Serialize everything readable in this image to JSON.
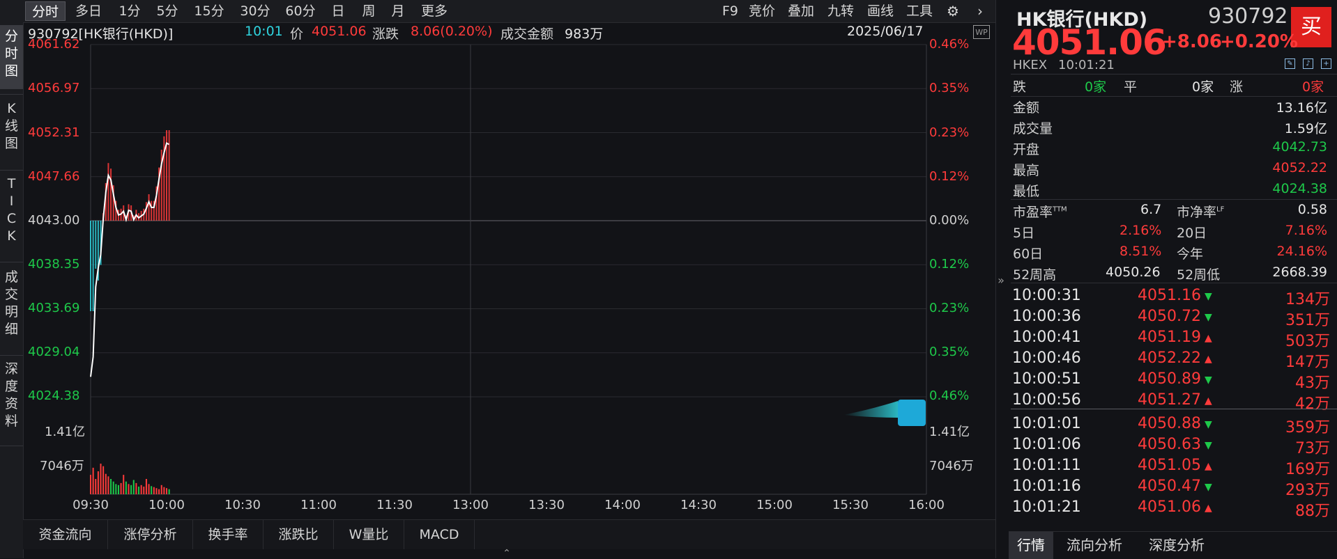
{
  "toolbar": {
    "periods": [
      "分时",
      "多日",
      "1分",
      "5分",
      "15分",
      "30分",
      "60分",
      "日",
      "周",
      "月",
      "更多"
    ],
    "tools": [
      "F9",
      "竞价",
      "叠加",
      "九转",
      "画线",
      "工具"
    ]
  },
  "left_tabs": [
    "分时图",
    "K线图",
    "TICK",
    "成交明细",
    "深度资料"
  ],
  "header": {
    "security": "930792[HK银行(HKD)]",
    "time": "10:01",
    "price_label": "价",
    "price": "4051.06",
    "change_label": "涨跌",
    "change": "8.06(0.20%)",
    "turnover_label": "成交金额",
    "turnover": "983万",
    "date": "2025/06/17"
  },
  "badge": "WP",
  "price_axis_left": [
    "4061.62",
    "4056.97",
    "4052.31",
    "4047.66",
    "4043.00",
    "4038.35",
    "4033.69",
    "4029.04",
    "4024.38"
  ],
  "pct_axis_right": [
    "0.46%",
    "0.35%",
    "0.23%",
    "0.12%",
    "0.00%",
    "0.12%",
    "0.23%",
    "0.35%",
    "0.46%"
  ],
  "volume_axis": {
    "top": "1.41亿",
    "mid": "7046万"
  },
  "time_axis": [
    "09:30",
    "10:00",
    "10:30",
    "11:00",
    "11:30",
    "13:00",
    "13:30",
    "14:00",
    "14:30",
    "15:00",
    "15:30",
    "16:00"
  ],
  "chart_data": {
    "type": "line",
    "title": "930792[HK银行(HKD)]",
    "prev_close": 4043.0,
    "ylim": [
      4024.38,
      4061.62
    ],
    "x": [
      "09:30",
      "09:31",
      "09:32",
      "09:33",
      "09:34",
      "09:35",
      "09:36",
      "09:37",
      "09:38",
      "09:39",
      "09:40",
      "09:41",
      "09:42",
      "09:43",
      "09:44",
      "09:45",
      "09:46",
      "09:47",
      "09:48",
      "09:49",
      "09:50",
      "09:51",
      "09:52",
      "09:53",
      "09:54",
      "09:55",
      "09:56",
      "09:57",
      "09:58",
      "09:59",
      "10:00",
      "10:01"
    ],
    "series": [
      {
        "values": [
          4026.5,
          4028.6,
          4036.0,
          4038.0,
          4039.4,
          4043.3,
          4046.0,
          4047.8,
          4047.3,
          4045.8,
          4044.4,
          4043.6,
          4043.7,
          4044.0,
          4043.1,
          4044.1,
          4044.0,
          4043.1,
          4043.6,
          4043.3,
          4043.5,
          4043.7,
          4044.3,
          4045.0,
          4044.4,
          4044.4,
          4045.7,
          4047.4,
          4049.0,
          4050.2,
          4051.2,
          4051.06
        ]
      }
    ],
    "volume_shares": [
      38,
      52,
      30,
      45,
      60,
      55,
      40,
      35,
      30,
      25,
      20,
      18,
      22,
      38,
      25,
      20,
      18,
      28,
      22,
      15,
      18,
      15,
      30,
      20,
      16,
      14,
      12,
      10,
      18,
      14,
      12,
      10
    ],
    "grid": true
  },
  "bottom_tabs": [
    "资金流向",
    "涨停分析",
    "换手率",
    "涨跌比",
    "W量比",
    "MACD"
  ],
  "quote": {
    "name": "HK银行(HKD)",
    "code": "930792",
    "price": "4051.06",
    "change": "+8.06",
    "change_pct": "+0.20%",
    "exchange": "HKEX",
    "time": "10:01:21",
    "buy_label": "买"
  },
  "breadth": {
    "down_label": "跌",
    "down": "0家",
    "flat_label": "平",
    "flat": "0家",
    "up_label": "涨",
    "up": "0家"
  },
  "stats": [
    {
      "label": "金额",
      "value": "13.16亿"
    },
    {
      "label": "成交量",
      "value": "1.59亿"
    },
    {
      "label": "开盘",
      "value": "4042.73"
    },
    {
      "label": "最高",
      "value": "4052.22"
    },
    {
      "label": "最低",
      "value": "4024.38"
    }
  ],
  "ratios": {
    "pe_label": "市盈率",
    "pe_sup": "TTM",
    "pe": "6.7",
    "pb_label": "市净率",
    "pb_sup": "LF",
    "pb": "0.58",
    "d5_label": "5日",
    "d5": "2.16%",
    "d20_label": "20日",
    "d20": "7.16%",
    "d60_label": "60日",
    "d60": "8.51%",
    "ytd_label": "今年",
    "ytd": "24.16%",
    "h52_label": "52周高",
    "h52": "4050.26",
    "l52_label": "52周低",
    "l52": "2668.39"
  },
  "ticks": [
    {
      "time": "10:00:31",
      "price": "4051.16",
      "dir": "down",
      "vol": "134万"
    },
    {
      "time": "10:00:36",
      "price": "4050.72",
      "dir": "down",
      "vol": "351万"
    },
    {
      "time": "10:00:41",
      "price": "4051.19",
      "dir": "up",
      "vol": "503万"
    },
    {
      "time": "10:00:46",
      "price": "4052.22",
      "dir": "up",
      "vol": "147万"
    },
    {
      "time": "10:00:51",
      "price": "4050.89",
      "dir": "down",
      "vol": "43万"
    },
    {
      "time": "10:00:56",
      "price": "4051.27",
      "dir": "up",
      "vol": "42万"
    },
    {
      "time": "10:01:01",
      "price": "4050.88",
      "dir": "down",
      "vol": "359万"
    },
    {
      "time": "10:01:06",
      "price": "4050.63",
      "dir": "down",
      "vol": "73万"
    },
    {
      "time": "10:01:11",
      "price": "4051.05",
      "dir": "up",
      "vol": "169万"
    },
    {
      "time": "10:01:16",
      "price": "4050.47",
      "dir": "down",
      "vol": "293万"
    },
    {
      "time": "10:01:21",
      "price": "4051.06",
      "dir": "up",
      "vol": "88万"
    }
  ],
  "right_tabs": [
    "行情",
    "流向分析",
    "深度分析"
  ],
  "colors": {
    "up": "#ff3b3b",
    "down": "#1ec94a",
    "accent": "#2fd3de",
    "buy": "#e0201e"
  }
}
